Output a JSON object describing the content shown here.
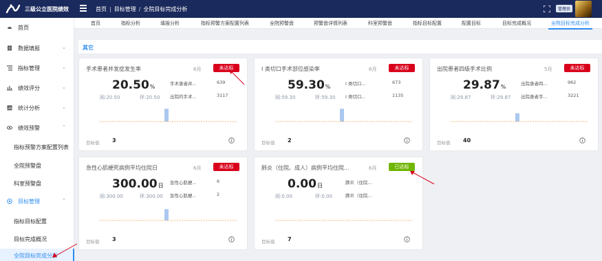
{
  "app": {
    "title": "三级公立医院绩效",
    "admin_label": "管理员"
  },
  "breadcrumb": [
    "首页",
    "目标管理",
    "全院目标完成分析"
  ],
  "sidebar": {
    "items": [
      {
        "label": "首页",
        "icon": "dashboard-icon"
      },
      {
        "label": "数据填报",
        "icon": "form-icon"
      },
      {
        "label": "指标管理",
        "icon": "list-icon"
      },
      {
        "label": "绩效评分",
        "icon": "score-icon"
      },
      {
        "label": "统计分析",
        "icon": "chart-icon"
      },
      {
        "label": "绩效预警",
        "icon": "eye-icon"
      },
      {
        "label": "指标预警方案配置列表"
      },
      {
        "label": "全院预警盘"
      },
      {
        "label": "科室预警盘"
      },
      {
        "label": "目标管理",
        "icon": "target-icon"
      },
      {
        "label": "指标目标配置"
      },
      {
        "label": "目标完成概况"
      },
      {
        "label": "全院目标完成分析"
      }
    ]
  },
  "tabs": [
    "首页",
    "指标分析",
    "填报分析",
    "指标预警方案配置列表",
    "全院预警盘",
    "预警盘详情列表",
    "科室预警盘",
    "指标目标配置",
    "配置目标",
    "目标完成概况",
    "全院目标完成分析"
  ],
  "section": {
    "title": "其它"
  },
  "labels": {
    "tong": "同",
    "huan": "环",
    "target": "目标值"
  },
  "status_colors": {
    "fail": "#d9001b",
    "pass": "#70b603",
    "accent": "#2d8cf0"
  },
  "cards": [
    {
      "title": "手术患者并发症发生率",
      "period": "6月",
      "status": "未达标",
      "status_type": "fail",
      "value": "20.50",
      "unit": "%",
      "tong": "同:20.50",
      "huan": "环:20.50",
      "subs": [
        {
          "label": "手术患者并...",
          "value": "639"
        },
        {
          "label": "出院的手术...",
          "value": "3117"
        }
      ],
      "bar_level": 0.85,
      "target": "3"
    },
    {
      "title": "I 类切口手术部位感染率",
      "period": "6月",
      "status": "未达标",
      "status_type": "fail",
      "value": "59.30",
      "unit": "%",
      "tong": "同:59.30",
      "huan": "环:59.30",
      "subs": [
        {
          "label": "I 类切口...",
          "value": "673"
        },
        {
          "label": "I 类切口...",
          "value": "1135"
        }
      ],
      "bar_level": 0.85,
      "target": "2"
    },
    {
      "title": "出院患者四级手术比例",
      "period": "5月",
      "status": "未达标",
      "status_type": "fail",
      "value": "29.87",
      "unit": "%",
      "tong": "同:29.87",
      "huan": "环:29.87",
      "subs": [
        {
          "label": "出院患者四...",
          "value": "962"
        },
        {
          "label": "出院患者手...",
          "value": "3221"
        }
      ],
      "bar_level": 0.55,
      "target": "40"
    },
    {
      "title": "急性心肌梗死病例平均住院日",
      "period": "6月",
      "status": "未达标",
      "status_type": "fail",
      "value": "300.00",
      "unit": "日",
      "tong": "同:300.00",
      "huan": "环:300.00",
      "subs": [
        {
          "label": "急性心肌梗...",
          "value": "6"
        },
        {
          "label": "急性心肌梗...",
          "value": "2"
        }
      ],
      "bar_level": 0.75,
      "target": "3"
    },
    {
      "title": "肺炎（住院、成人）病例平均住院...",
      "period": "6月",
      "status": "已达标",
      "status_type": "pass",
      "value": "0.00",
      "unit": "日",
      "tong": "同:0.00",
      "huan": "环:0.00",
      "subs": [
        {
          "label": "肺炎（住院...",
          "value": ""
        },
        {
          "label": "肺炎（住院...",
          "value": ""
        }
      ],
      "bar_level": 0,
      "target": "7"
    }
  ]
}
